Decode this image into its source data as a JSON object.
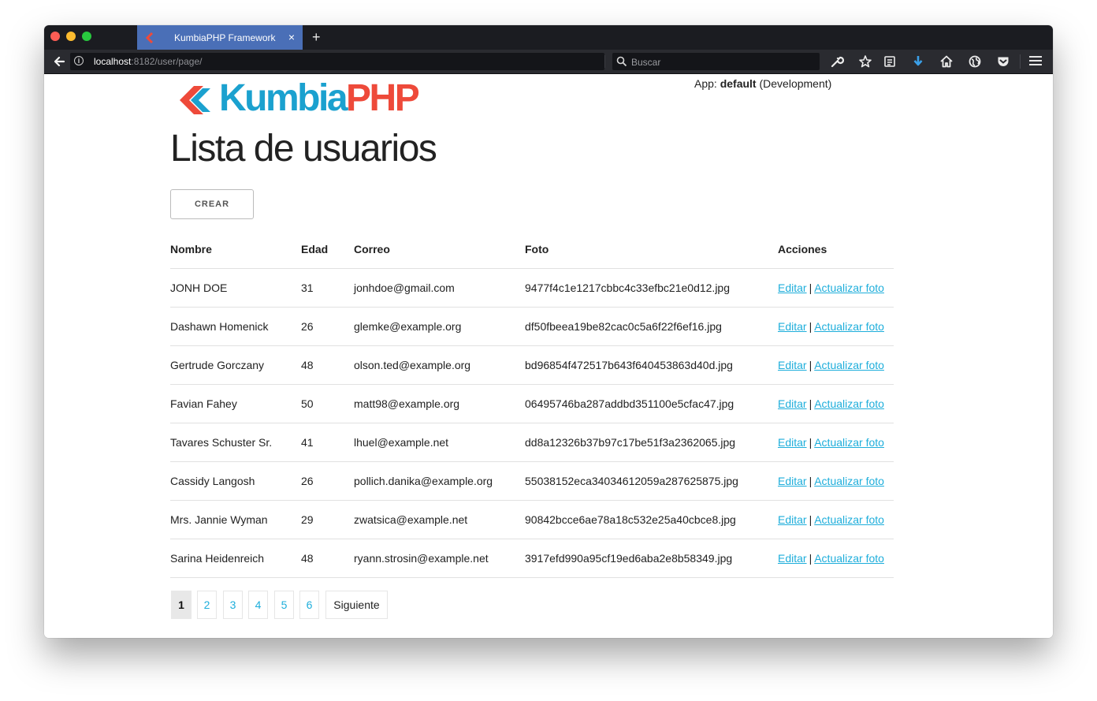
{
  "browser": {
    "tab_title": "KumbiaPHP Framework",
    "tab_close": "×",
    "new_tab": "+",
    "url_host": "localhost",
    "url_rest": ":8182/user/page/",
    "search_placeholder": "Buscar"
  },
  "header": {
    "logo_part1": "Kumbia",
    "logo_part2": "PHP",
    "app_label": "App:",
    "app_name": "default",
    "app_env": "(Development)"
  },
  "main": {
    "title": "Lista de usuarios",
    "create_button": "CREAR",
    "columns": [
      "Nombre",
      "Edad",
      "Correo",
      "Foto",
      "Acciones"
    ],
    "rows": [
      {
        "nombre": "JONH DOE",
        "edad": "31",
        "correo": "jonhdoe@gmail.com",
        "foto": "9477f4c1e1217cbbc4c33efbc21e0d12.jpg"
      },
      {
        "nombre": "Dashawn Homenick",
        "edad": "26",
        "correo": "glemke@example.org",
        "foto": "df50fbeea19be82cac0c5a6f22f6ef16.jpg"
      },
      {
        "nombre": "Gertrude Gorczany",
        "edad": "48",
        "correo": "olson.ted@example.org",
        "foto": "bd96854f472517b643f640453863d40d.jpg"
      },
      {
        "nombre": "Favian Fahey",
        "edad": "50",
        "correo": "matt98@example.org",
        "foto": "06495746ba287addbd351100e5cfac47.jpg"
      },
      {
        "nombre": "Tavares Schuster Sr.",
        "edad": "41",
        "correo": "lhuel@example.net",
        "foto": "dd8a12326b37b97c17be51f3a2362065.jpg"
      },
      {
        "nombre": "Cassidy Langosh",
        "edad": "26",
        "correo": "pollich.danika@example.org",
        "foto": "55038152eca34034612059a287625875.jpg"
      },
      {
        "nombre": "Mrs. Jannie Wyman",
        "edad": "29",
        "correo": "zwatsica@example.net",
        "foto": "90842bcce6ae78a18c532e25a40cbce8.jpg"
      },
      {
        "nombre": "Sarina Heidenreich",
        "edad": "48",
        "correo": "ryann.strosin@example.net",
        "foto": "3917efd990a95cf19ed6aba2e8b58349.jpg"
      }
    ],
    "action_edit": "Editar",
    "action_separator": "|",
    "action_photo": "Actualizar foto"
  },
  "pagination": {
    "pages": [
      "1",
      "2",
      "3",
      "4",
      "5",
      "6"
    ],
    "current": "1",
    "next": "Siguiente"
  },
  "colors": {
    "link": "#1eaedb",
    "logo_blue": "#1ba1cf",
    "logo_red": "#ee4a3a",
    "tab_active": "#4a6fb7",
    "chrome_dark": "#1b1c21"
  },
  "icons": [
    "back-arrow-icon",
    "info-icon",
    "reload-icon",
    "search-icon",
    "wrench-icon",
    "star-icon",
    "reader-icon",
    "download-icon",
    "home-icon",
    "globe-icon",
    "pocket-icon",
    "hamburger-menu-icon",
    "kumbia-chevron-icon"
  ]
}
